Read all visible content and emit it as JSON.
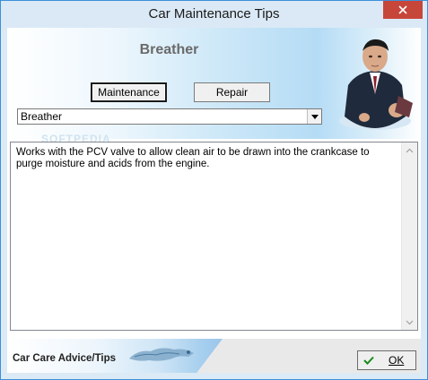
{
  "window": {
    "title": "Car Maintenance Tips"
  },
  "header": {
    "heading": "Breather"
  },
  "buttons": {
    "maintenance": "Maintenance",
    "repair": "Repair",
    "ok": "OK"
  },
  "dropdown": {
    "selected": "Breather"
  },
  "description": {
    "text": "Works with the PCV valve to allow clean air to be drawn into the crankcase to purge moisture and acids from the engine."
  },
  "footer": {
    "label": "Car Care Advice/Tips"
  },
  "watermark": "SOFTPEDIA",
  "icons": {
    "close": "close-icon",
    "dropdown": "chevron-down-icon",
    "ok": "checkmark-icon"
  }
}
